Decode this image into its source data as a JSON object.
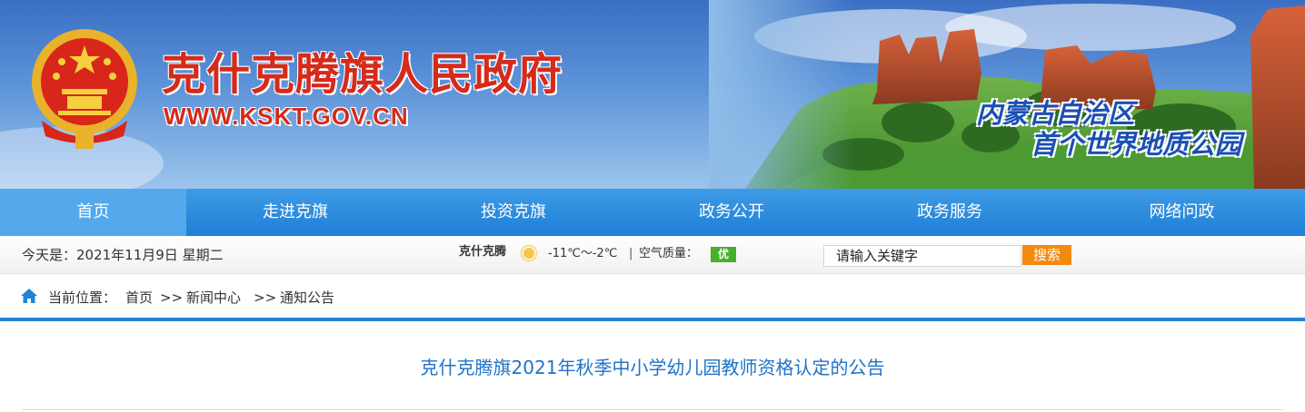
{
  "header": {
    "site_name": "克什克腾旗人民政府",
    "site_url": "WWW.KSKT.GOV.CN",
    "slogan_line1": "内蒙古自治区",
    "slogan_line2": "首个世界地质公园"
  },
  "nav": {
    "items": [
      {
        "label": "首页"
      },
      {
        "label": "走进克旗"
      },
      {
        "label": "投资克旗"
      },
      {
        "label": "政务公开"
      },
      {
        "label": "政务服务"
      },
      {
        "label": "网络问政"
      }
    ]
  },
  "infobar": {
    "today": "今天是：2021年11月9日 星期二",
    "weather_city": "克什克腾",
    "weather_icon": "sun-icon",
    "weather_temp": "-11℃～-2℃",
    "separator": "|",
    "air_quality_label": "空气质量：",
    "air_quality_value": "优",
    "search_placeholder": "请输入关键字",
    "search_button": "搜索"
  },
  "breadcrumb": {
    "label": "当前位置：",
    "items": [
      "首页",
      "新闻中心",
      "通知公告"
    ],
    "separator": ">>"
  },
  "article": {
    "title": "克什克腾旗2021年秋季中小学幼儿园教师资格认定的公告"
  },
  "colors": {
    "nav_blue": "#1f7fd6",
    "nav_active": "#53a9ec",
    "site_name_red": "#d62a1a",
    "slogan_blue": "#1a4fb5",
    "title_blue": "#1f73c6",
    "search_orange": "#f28a12",
    "aq_green": "#4aae2e"
  }
}
